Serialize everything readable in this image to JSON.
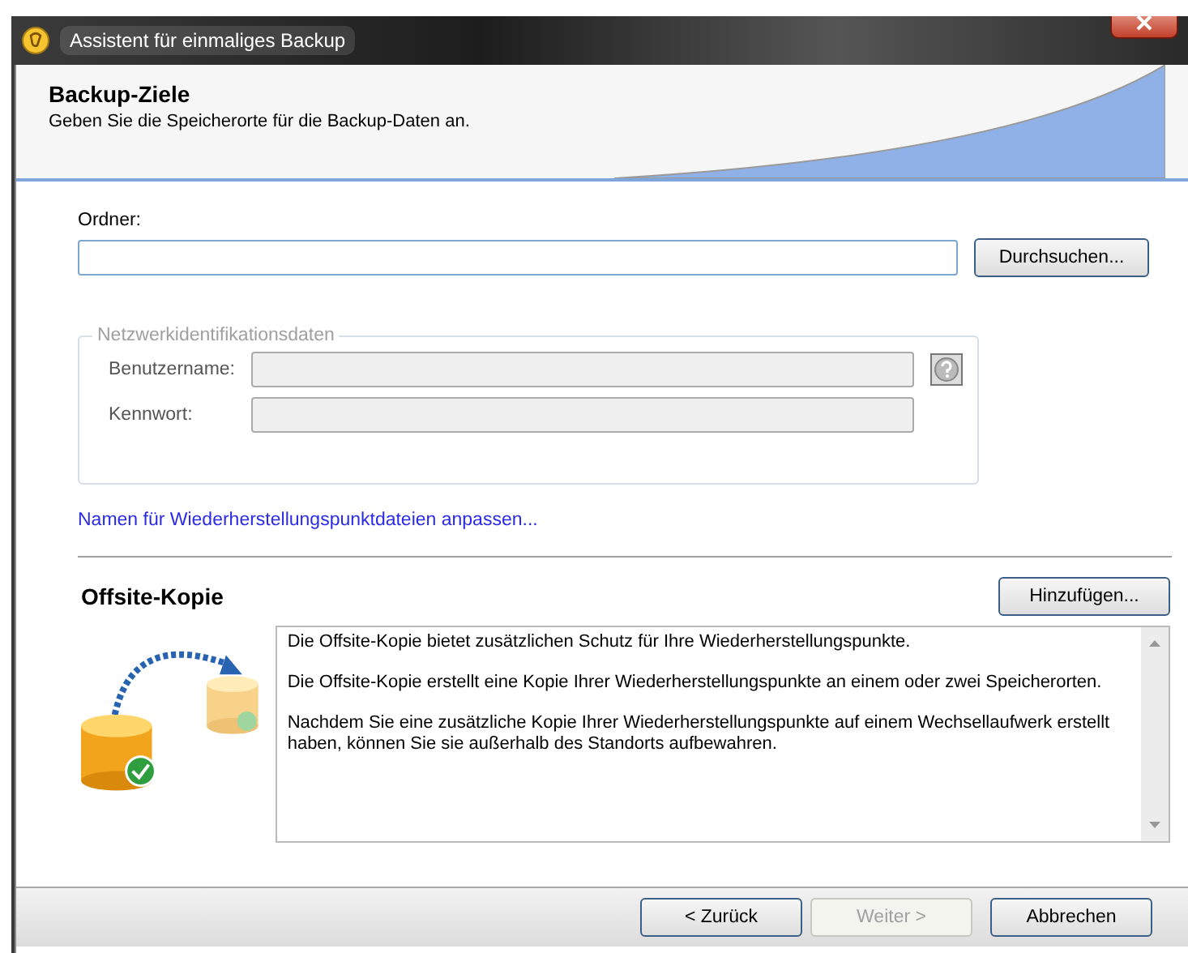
{
  "window": {
    "title": "Assistent für einmaliges Backup"
  },
  "header": {
    "title": "Backup-Ziele",
    "subtitle": "Geben Sie die Speicherorte für die Backup-Daten an."
  },
  "folder": {
    "label": "Ordner:",
    "browse_button": "Durchsuchen..."
  },
  "network": {
    "legend": "Netzwerkidentifikationsdaten",
    "disabled": true,
    "fields": [
      {
        "label": "Benutzername:",
        "help": true
      },
      {
        "label": "Kennwort:",
        "help": false
      }
    ]
  },
  "rename_link": "Namen für Wiederherstellungspunktdateien anpassen...",
  "offsite": {
    "title": "Offsite-Kopie",
    "add_button": "Hinzufügen...",
    "paragraphs": [
      "Die Offsite-Kopie bietet zusätzlichen Schutz für Ihre Wiederherstellungspunkte.",
      "Die Offsite-Kopie erstellt eine Kopie Ihrer Wiederherstellungspunkte an einem oder zwei Speicherorten.",
      "Nachdem Sie eine zusätzliche Kopie Ihrer Wiederherstellungspunkte auf einem Wechsellaufwerk erstellt haben, können Sie sie außerhalb des Standorts aufbewahren."
    ]
  },
  "buttons": [
    {
      "label": "< Zurück",
      "disabled": false
    },
    {
      "label": "Weiter >",
      "disabled": true
    },
    {
      "label": "Abbrechen",
      "disabled": false
    }
  ]
}
